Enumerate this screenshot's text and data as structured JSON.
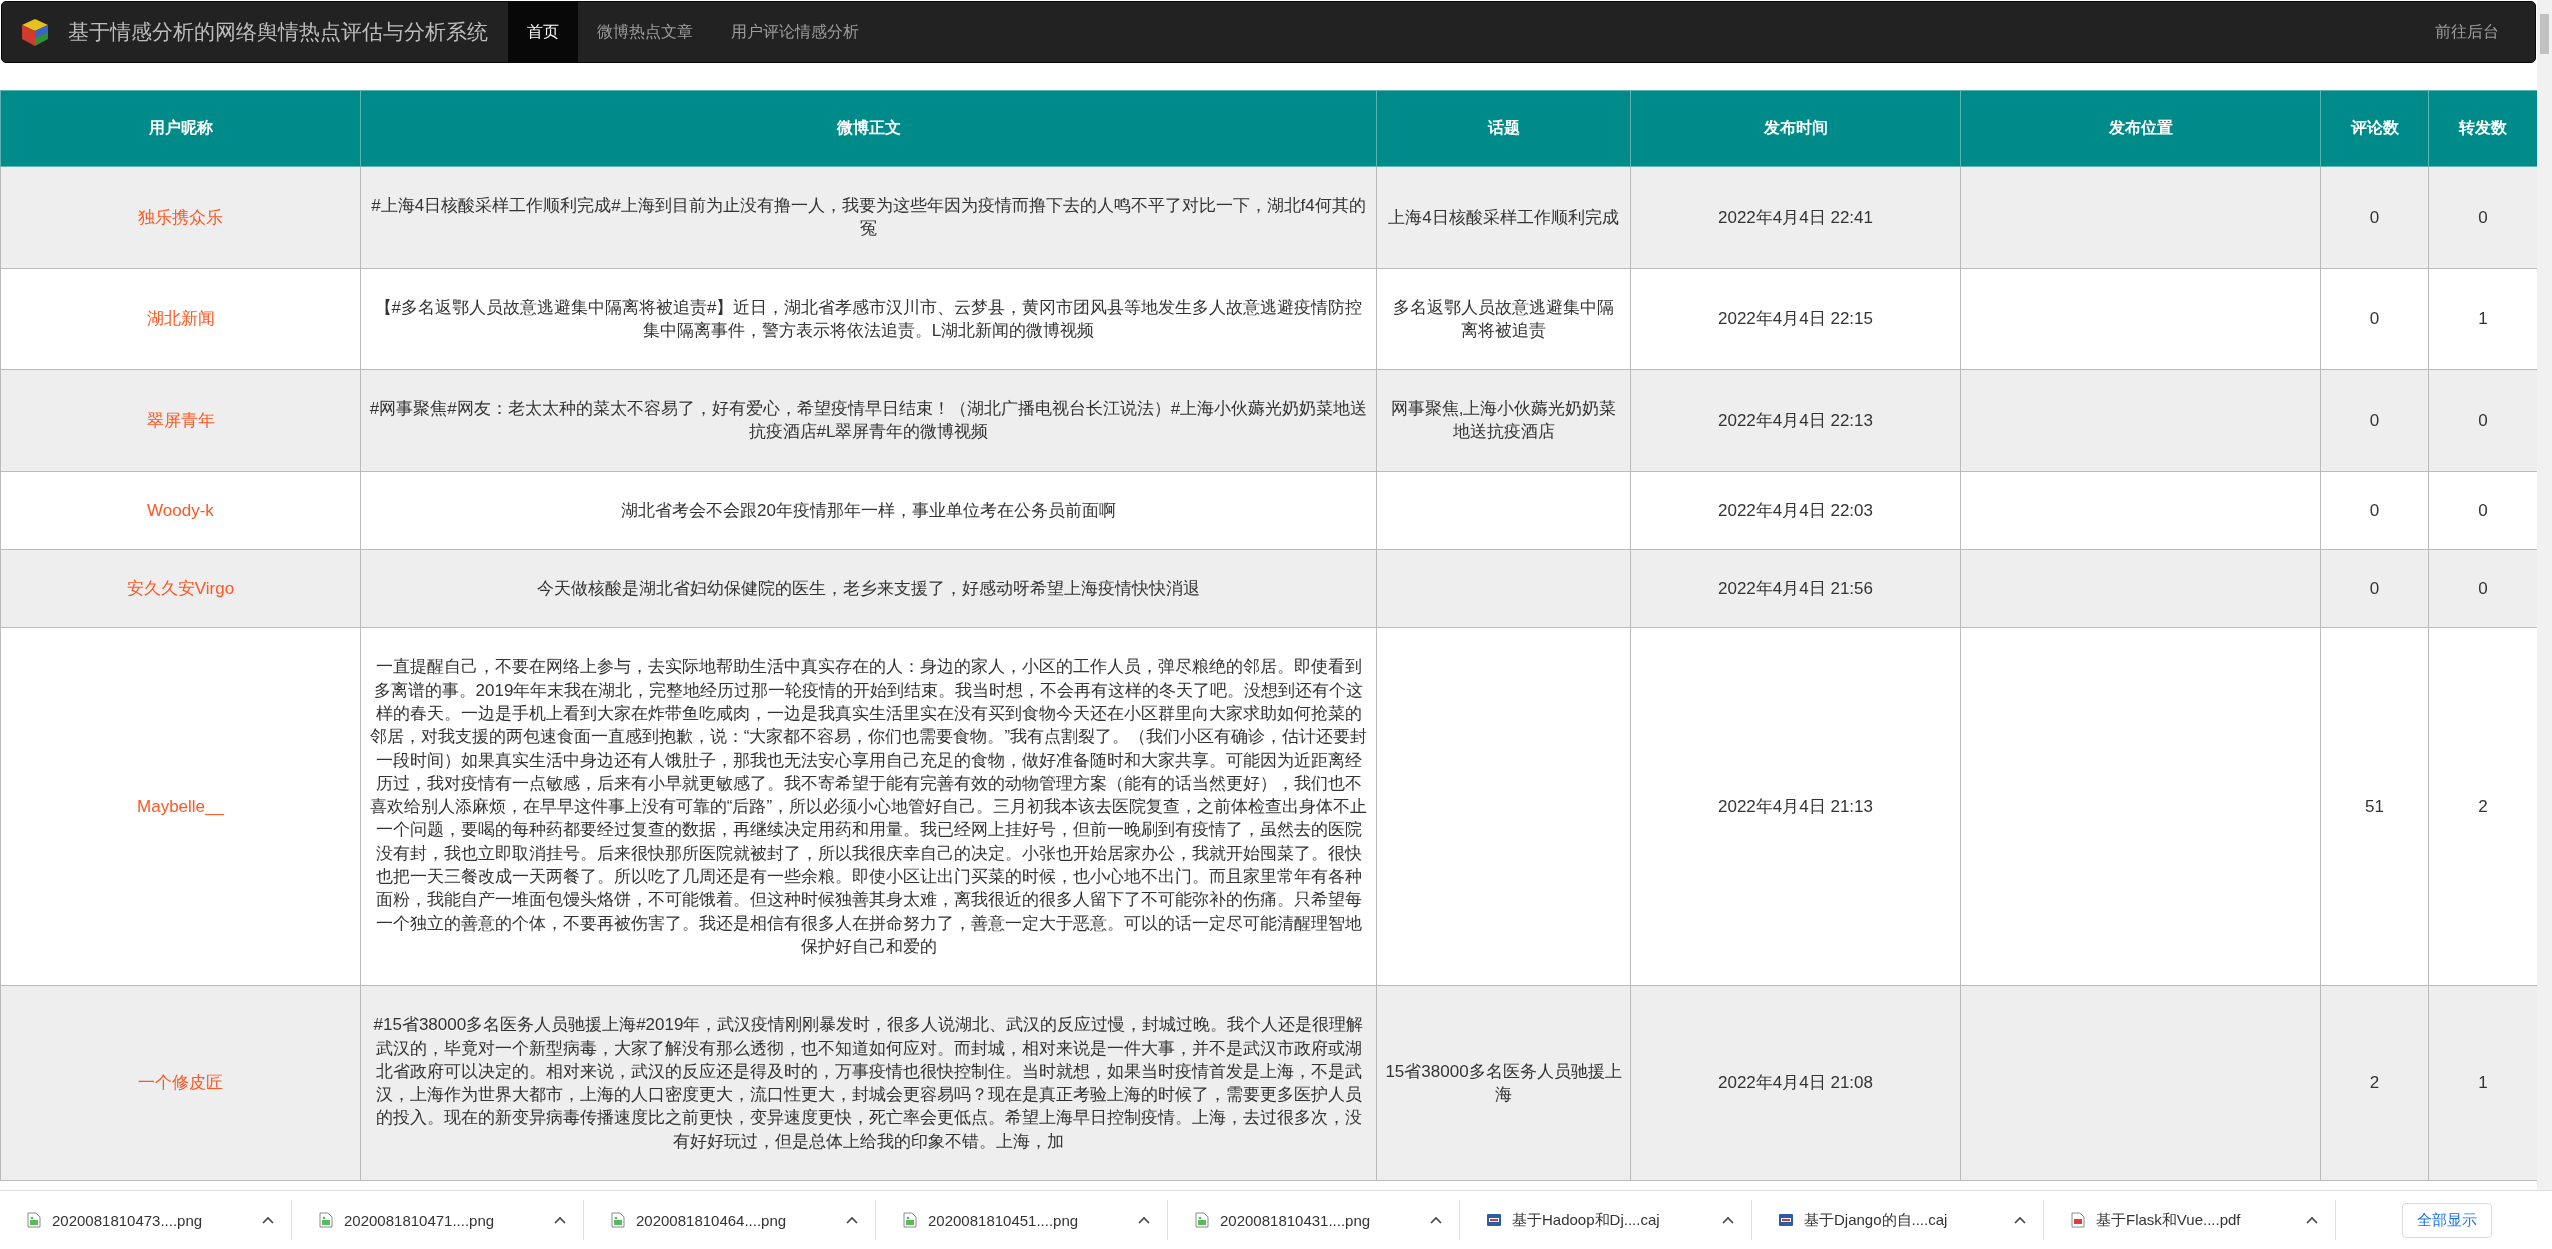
{
  "navbar": {
    "title": "基于情感分析的网络舆情热点评估与分析系统",
    "links": [
      {
        "label": "首页",
        "selected": true
      },
      {
        "label": "微博热点文章",
        "selected": false
      },
      {
        "label": "用户评论情感分析",
        "selected": false
      }
    ],
    "right_link": "前往后台"
  },
  "table": {
    "columns": [
      "用户昵称",
      "微博正文",
      "话题",
      "发布时间",
      "发布位置",
      "评论数",
      "转发数"
    ],
    "rows": [
      {
        "user": "独乐携众乐",
        "text": "#上海4日核酸采样工作顺利完成#上海到目前为止没有撸一人，我要为这些年因为疫情而撸下去的人鸣不平了对比一下，湖北f4何其的冤",
        "topic": "上海4日核酸采样工作顺利完成",
        "time": "2022年4月4日 22:41",
        "comments": "0",
        "reposts": "0"
      },
      {
        "user": "湖北新闻",
        "text": "【#多名返鄂人员故意逃避集中隔离将被追责#】近日，湖北省孝感市汉川市、云梦县，黄冈市团风县等地发生多人故意逃避疫情防控集中隔离事件，警方表示将依法追责。L湖北新闻的微博视频",
        "topic": "多名返鄂人员故意逃避集中隔离将被追责",
        "time": "2022年4月4日 22:15",
        "comments": "0",
        "reposts": "1"
      },
      {
        "user": "翠屏青年",
        "text": "#网事聚焦#网友：老太太种的菜太不容易了，好有爱心，希望疫情早日结束！（湖北广播电视台长江说法）#上海小伙薅光奶奶菜地送抗疫酒店#L翠屏青年的微博视频",
        "topic": "网事聚焦,上海小伙薅光奶奶菜地送抗疫酒店",
        "time": "2022年4月4日 22:13",
        "comments": "0",
        "reposts": "0"
      },
      {
        "user": "Woody-k",
        "text": "湖北省考会不会跟20年疫情那年一样，事业单位考在公务员前面啊",
        "time": "2022年4月4日 22:03",
        "comments": "0",
        "reposts": "0"
      },
      {
        "user": "安久久安Virgo",
        "text": "今天做核酸是湖北省妇幼保健院的医生，老乡来支援了，好感动呀希望上海疫情快快消退",
        "time": "2022年4月4日 21:56",
        "comments": "0",
        "reposts": "0"
      },
      {
        "user": "Maybelle__",
        "text": "一直提醒自己，不要在网络上参与，去实际地帮助生活中真实存在的人：身边的家人，小区的工作人员，弹尽粮绝的邻居。即使看到多离谱的事。2019年年末我在湖北，完整地经历过那一轮疫情的开始到结束。我当时想，不会再有这样的冬天了吧。没想到还有个这样的春天。一边是手机上看到大家在炸带鱼吃咸肉，一边是我真实生活里实在没有买到食物今天还在小区群里向大家求助如何抢菜的邻居，对我支援的两包速食面一直感到抱歉，说：“大家都不容易，你们也需要食物。”我有点割裂了。（我们小区有确诊，估计还要封一段时间）如果真实生活中身边还有人饿肚子，那我也无法安心享用自己充足的食物，做好准备随时和大家共享。可能因为近距离经历过，我对疫情有一点敏感，后来有小早就更敏感了。我不寄希望于能有完善有效的动物管理方案（能有的话当然更好），我们也不喜欢给别人添麻烦，在早早这件事上没有可靠的“后路”，所以必须小心地管好自己。三月初我本该去医院复查，之前体检查出身体不止一个问题，要喝的每种药都要经过复查的数据，再继续决定用药和用量。我已经网上挂好号，但前一晚刷到有疫情了，虽然去的医院没有封，我也立即取消挂号。后来很快那所医院就被封了，所以我很庆幸自己的决定。小张也开始居家办公，我就开始囤菜了。很快也把一天三餐改成一天两餐了。所以吃了几周还是有一些余粮。即使小区让出门买菜的时候，也小心地不出门。而且家里常年有各种面粉，我能自产一堆面包馒头烙饼，不可能饿着。但这种时候独善其身太难，离我很近的很多人留下了不可能弥补的伤痛。只希望每一个独立的善意的个体，不要再被伤害了。我还是相信有很多人在拼命努力了，善意一定大于恶意。可以的话一定尽可能清醒理智地保护好自己和爱的",
        "time": "2022年4月4日 21:13",
        "comments": "51",
        "reposts": "2"
      },
      {
        "user": "一个修皮匠",
        "text": "#15省38000多名医务人员驰援上海#2019年，武汉疫情刚刚暴发时，很多人说湖北、武汉的反应过慢，封城过晚。我个人还是很理解武汉的，毕竟对一个新型病毒，大家了解没有那么透彻，也不知道如何应对。而封城，相对来说是一件大事，并不是武汉市政府或湖北省政府可以决定的。相对来说，武汉的反应还是得及时的，万事疫情也很快控制住。当时就想，如果当时疫情首发是上海，不是武汉，上海作为世界大都市，上海的人口密度更大，流口性更大，封城会更容易吗？现在是真正考验上海的时候了，需要更多医护人员的投入。现在的新变异病毒传播速度比之前更快，变异速度更快，死亡率会更低点。希望上海早日控制疫情。上海，去过很多次，没有好好玩过，但是总体上给我的印象不错。上海，加",
        "topic": "15省38000多名医务人员驰援上海",
        "time": "2022年4月4日 21:08",
        "comments": "2",
        "reposts": "1"
      }
    ]
  },
  "downloads": {
    "items": [
      {
        "name": "2020081810473....png",
        "kind": "image"
      },
      {
        "name": "2020081810471....png",
        "kind": "image"
      },
      {
        "name": "2020081810464....png",
        "kind": "image"
      },
      {
        "name": "2020081810451....png",
        "kind": "image"
      },
      {
        "name": "2020081810431....png",
        "kind": "image"
      },
      {
        "name": "基于Hadoop和Dj....caj",
        "kind": "caj"
      },
      {
        "name": "基于Django的自....caj",
        "kind": "caj"
      },
      {
        "name": "基于Flask和Vue....pdf",
        "kind": "pdf"
      }
    ],
    "show_all": "全部显示"
  }
}
